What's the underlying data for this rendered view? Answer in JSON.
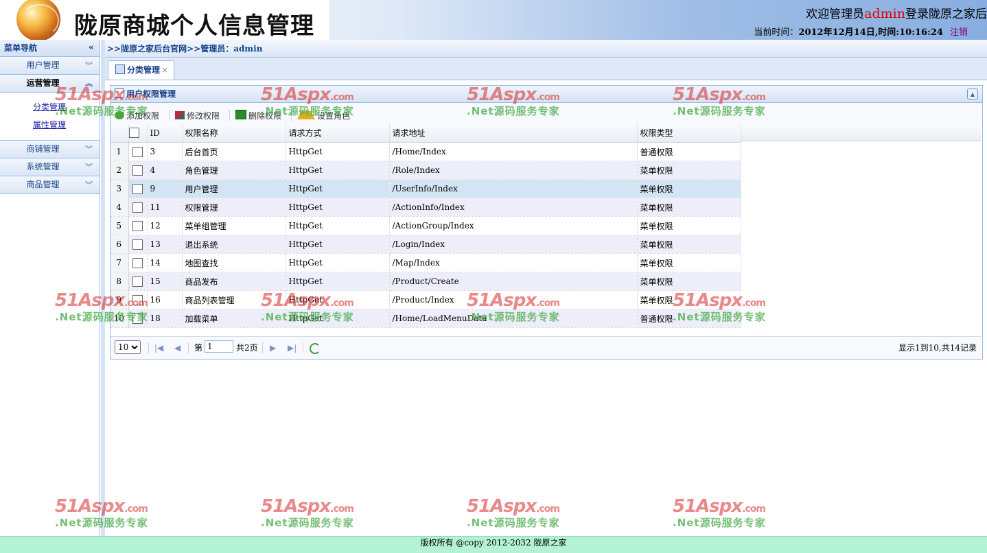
{
  "header": {
    "site_title": "陇原商城个人信息管理",
    "welcome_prefix": "欢迎管理员",
    "admin_name": "admin",
    "welcome_suffix": "登录陇原之家后",
    "time_label": "当前时间：",
    "time_value": "2012年12月14日,时间:10:16:24",
    "logout": "注销"
  },
  "sidebar": {
    "title": "菜单导航",
    "groups": [
      {
        "label": "用户管理"
      },
      {
        "label": "运营管理"
      },
      {
        "label": "商铺管理"
      },
      {
        "label": "系统管理"
      },
      {
        "label": "商品管理"
      }
    ],
    "sub_items": [
      {
        "label": "分类管理"
      },
      {
        "label": "属性管理"
      }
    ]
  },
  "breadcrumb": ">>陇原之家后台官网>>管理员：admin",
  "tab": {
    "label": "分类管理",
    "close": "×"
  },
  "panel": {
    "title": "用户权限管理",
    "toolbar": {
      "add": "添加权限",
      "edit": "修改权限",
      "delete": "删除权限",
      "role": "设置角色"
    }
  },
  "grid": {
    "columns": {
      "id": "ID",
      "name": "权限名称",
      "method": "请求方式",
      "url": "请求地址",
      "type": "权限类型"
    },
    "rows": [
      {
        "n": "1",
        "id": "3",
        "name": "后台首页",
        "method": "HttpGet",
        "url": "/Home/Index",
        "type": "普通权限"
      },
      {
        "n": "2",
        "id": "4",
        "name": "角色管理",
        "method": "HttpGet",
        "url": "/Role/Index",
        "type": "菜单权限"
      },
      {
        "n": "3",
        "id": "9",
        "name": "用户管理",
        "method": "HttpGet",
        "url": "/UserInfo/Index",
        "type": "菜单权限"
      },
      {
        "n": "4",
        "id": "11",
        "name": "权限管理",
        "method": "HttpGet",
        "url": "/ActionInfo/Index",
        "type": "菜单权限"
      },
      {
        "n": "5",
        "id": "12",
        "name": "菜单组管理",
        "method": "HttpGet",
        "url": "/ActionGroup/Index",
        "type": "菜单权限"
      },
      {
        "n": "6",
        "id": "13",
        "name": "退出系统",
        "method": "HttpGet",
        "url": "/Login/Index",
        "type": "菜单权限"
      },
      {
        "n": "7",
        "id": "14",
        "name": "地图查找",
        "method": "HttpGet",
        "url": "/Map/Index",
        "type": "菜单权限"
      },
      {
        "n": "8",
        "id": "15",
        "name": "商品发布",
        "method": "HttpGet",
        "url": "/Product/Create",
        "type": "菜单权限"
      },
      {
        "n": "9",
        "id": "16",
        "name": "商品列表管理",
        "method": "HttpGet",
        "url": "/Product/Index",
        "type": "菜单权限"
      },
      {
        "n": "10",
        "id": "18",
        "name": "加载菜单",
        "method": "HttpGet",
        "url": "/Home/LoadMenuData",
        "type": "普通权限"
      }
    ]
  },
  "pager": {
    "page_size": "10",
    "page_prefix": "第",
    "page_value": "1",
    "page_total": "共2页",
    "info": "显示1到10,共14记录"
  },
  "footer": "版权所有 @copy 2012-2032 陇原之家",
  "watermark": {
    "brand": "51Aspx",
    "domain": ".com",
    "slogan": ".Net源码服务专家"
  }
}
